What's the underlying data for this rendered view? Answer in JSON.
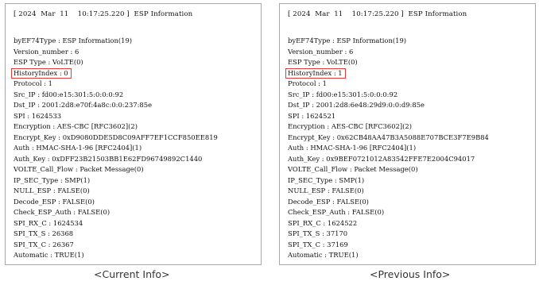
{
  "panels": [
    {
      "header": "[ 2024  Mar  11    10:17:25.220 ]  ESP Information",
      "lines": [
        "byEF74Type : ESP Information(19)",
        "Version_number : 6",
        "ESP Type : VoLTE(0)",
        "HistoryIndex : 0",
        "Protocol : 1",
        "Src_IP : fd00:e15:301:5:0:0:0:92",
        "Dst_IP : 2001:2d8:e70f:4a8c:0:0:237:85e",
        "SPI : 1624533",
        "Encryption : AES-CBC [RFC3602](2)",
        "Encrypt_Key : 0xD9080DDE5D8C09AFF7EF1CCF850EE819",
        "Auth : HMAC-SHA-1-96 [RFC2404](1)",
        "Auth_Key : 0xDFF23B21503BB1E62FD96749892C1440",
        "VOLTE_Call_Flow : Packet Message(0)",
        "IP_SEC_Type : SMP(1)",
        "NULL_ESP : FALSE(0)",
        "Decode_ESP : FALSE(0)",
        "Check_ESP_Auth : FALSE(0)",
        "SPI_RX_C : 1624534",
        "SPI_TX_S : 26368",
        "SPI_TX_C : 26367",
        "Automatic : TRUE(1)"
      ],
      "caption": "<Current Info>"
    },
    {
      "header": "[ 2024  Mar  11    10:17:25.220 ]  ESP Information",
      "lines": [
        "byEF74Type : ESP Information(19)",
        "Version_number : 6",
        "ESP Type : VoLTE(0)",
        "HistoryIndex : 1",
        "Protocol : 1",
        "Src_IP : fd00:e15:301:5:0:0:0:92",
        "Dst_IP : 2001:2d8:6e48:29d9:0:0:d9:85e",
        "SPI : 1624521",
        "Encryption : AES-CBC [RFC3602](2)",
        "Encrypt_Key : 0x62CB48AA47B3A5088E707BCE3F7E9B84",
        "Auth : HMAC-SHA-1-96 [RFC2404](1)",
        "Auth_Key : 0x9BEF0721012A83542FFE7E2004C94017",
        "VOLTE_Call_Flow : Packet Message(0)",
        "IP_SEC_Type : SMP(1)",
        "NULL_ESP : FALSE(0)",
        "Decode_ESP : FALSE(0)",
        "Check_ESP_Auth : FALSE(0)",
        "SPI_RX_C : 1624522",
        "SPI_TX_S : 37170",
        "SPI_TX_C : 37169",
        "Automatic : TRUE(1)"
      ],
      "caption": "<Previous Info>"
    }
  ],
  "highlight_color": "#e03a3a"
}
